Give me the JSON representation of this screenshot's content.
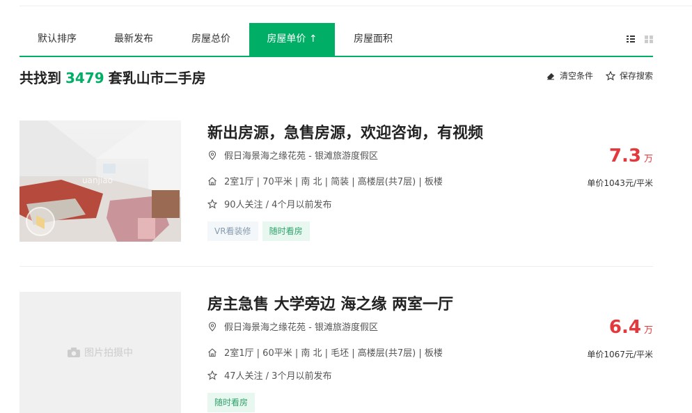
{
  "sort_tabs": [
    "默认排序",
    "最新发布",
    "房屋总价",
    "房屋单价 ↑",
    "房屋面积"
  ],
  "view_toggle": {
    "list_icon": "list-view-icon",
    "grid_icon": "grid-view-icon"
  },
  "summary": {
    "prefix": "共找到",
    "count": "3479",
    "suffix": "套乳山市二手房"
  },
  "actions": {
    "clear": "清空条件",
    "save": "保存搜索"
  },
  "listings": [
    {
      "title": "新出房源，急售房源，欢迎咨询，有视频",
      "community": "假日海景海之缘花苑",
      "separator": "-",
      "area": "银滩旅游度假区",
      "house_info": "2室1厅 | 70平米 | 南 北 | 简装 | 高楼层(共7层) | 板楼",
      "follow_info": "90人关注 / 4个月以前发布",
      "tags": [
        "VR看装修",
        "随时看房"
      ],
      "total_price": "7.3",
      "price_unit": "万",
      "unit_price": "单价1043元/平米",
      "photo_watermark": "uanjiao"
    },
    {
      "title": "房主急售 大学旁边 海之缘 两室一厅",
      "community": "假日海景海之缘花苑",
      "separator": "-",
      "area": "银滩旅游度假区",
      "house_info": "2室1厅 | 60平米 | 南 北 | 毛坯 | 高楼层(共7层) | 板楼",
      "follow_info": "47人关注 / 3个月以前发布",
      "tags": [
        "随时看房"
      ],
      "total_price": "6.4",
      "price_unit": "万",
      "unit_price": "单价1067元/平米",
      "photo_placeholder": "图片拍摄中"
    }
  ],
  "colors": {
    "accent": "#00ae66",
    "price": "#e4393c"
  }
}
